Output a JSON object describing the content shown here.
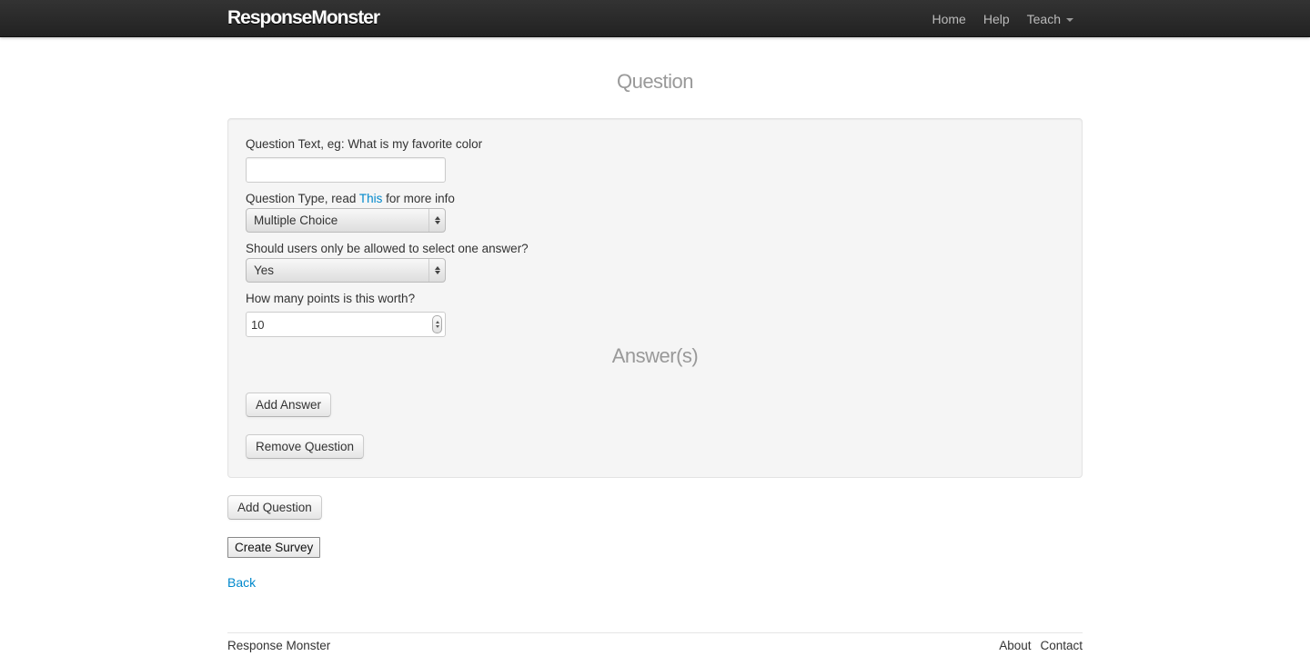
{
  "navbar": {
    "brand": "ResponseMonster",
    "links": [
      {
        "label": "Home"
      },
      {
        "label": "Help"
      },
      {
        "label": "Teach"
      }
    ]
  },
  "page": {
    "title": "Question"
  },
  "question_form": {
    "question_text_label": "Question Text, eg: What is my favorite color",
    "question_text_value": "",
    "question_type_label_prefix": "Question Type, read ",
    "question_type_label_link": "This",
    "question_type_label_suffix": " for more info",
    "question_type_value": "Multiple Choice",
    "single_answer_label": "Should users only be allowed to select one answer?",
    "single_answer_value": "Yes",
    "points_label": "How many points is this worth?",
    "points_value": "10",
    "answers_title": "Answer(s)",
    "add_answer_label": "Add Answer",
    "remove_question_label": "Remove Question"
  },
  "actions": {
    "add_question_label": "Add Question",
    "create_survey_label": "Create Survey",
    "back_label": "Back"
  },
  "footer": {
    "left": "Response Monster",
    "links": [
      {
        "label": "About"
      },
      {
        "label": "Contact"
      }
    ]
  }
}
